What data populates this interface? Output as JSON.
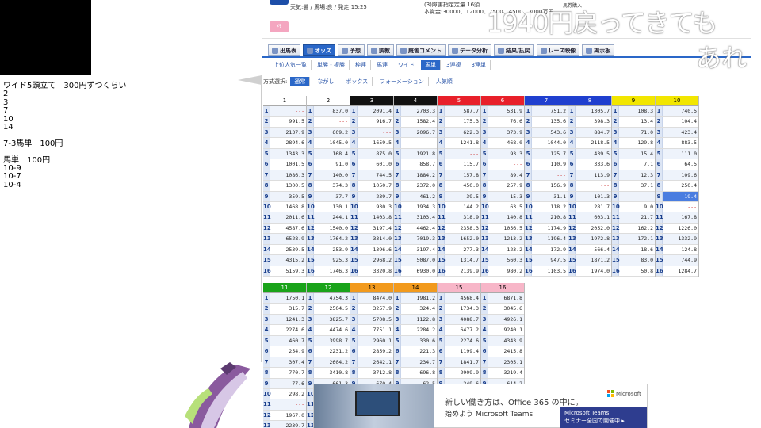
{
  "header": {
    "info_line1": "天気:曇 / 馬場:良 / 発走:15:25",
    "info_line2": "(3)障害指定定量 16頭",
    "info_line3": "本賞金:30000、12000、7500、4500、3000万円",
    "buy_label": "馬券購入",
    "pink_button": "ﾒﾓ"
  },
  "stream_overlay": {
    "line1": "1940円戻ってきても",
    "line2": "あれ"
  },
  "memo": {
    "lines": [
      "ワイド5頭立て　300円ずつくらい",
      "2",
      "3",
      "7",
      "10",
      "14",
      "",
      "7-3馬単　100円",
      "",
      "馬単　100円",
      "10-9",
      "10-7",
      "10-4"
    ]
  },
  "main_tabs": [
    {
      "label": "出馬表",
      "icon": "list-icon"
    },
    {
      "label": "オッズ",
      "icon": "odds-icon",
      "active": true
    },
    {
      "label": "予想",
      "icon": "target-icon"
    },
    {
      "label": "調教",
      "icon": "horse-icon"
    },
    {
      "label": "厩舎コメント",
      "icon": "stable-icon"
    },
    {
      "label": "データ分析",
      "icon": "data-icon"
    },
    {
      "label": "結果/払戻",
      "icon": "result-icon"
    },
    {
      "label": "レース映像",
      "icon": "video-icon"
    },
    {
      "label": "掲示板",
      "icon": "board-icon"
    }
  ],
  "sub_tabs": [
    {
      "label": "上位人気一覧"
    },
    {
      "label": "単勝・複勝"
    },
    {
      "label": "枠連"
    },
    {
      "label": "馬連"
    },
    {
      "label": "ワイド"
    },
    {
      "label": "馬単",
      "active": true
    },
    {
      "label": "3連複"
    },
    {
      "label": "3連単"
    }
  ],
  "mode": {
    "label": "方式選択:",
    "buttons": [
      {
        "label": "通常",
        "active": true
      },
      {
        "label": "ながし"
      },
      {
        "label": "ボックス"
      },
      {
        "label": "フォーメーション"
      },
      {
        "label": "人気順"
      }
    ]
  },
  "odds_top": {
    "columns": [
      {
        "head": "1",
        "color": "#ffffff",
        "text": "#000",
        "values": [
          "---",
          "991.5",
          "2137.9",
          "2894.6",
          "1343.3",
          "1001.5",
          "1086.3",
          "1300.5",
          "359.5",
          "1468.8",
          "2011.6",
          "4587.6",
          "6528.9",
          "2539.5",
          "4315.2",
          "5159.3"
        ]
      },
      {
        "head": "2",
        "color": "#ffffff",
        "text": "#000",
        "values": [
          "837.0",
          "---",
          "609.2",
          "1045.0",
          "168.4",
          "91.0",
          "140.0",
          "374.3",
          "37.7",
          "130.1",
          "244.1",
          "1540.0",
          "1764.2",
          "253.9",
          "925.3",
          "1746.3"
        ]
      },
      {
        "head": "3",
        "color": "#111111",
        "text": "#fff",
        "values": [
          "2091.4",
          "916.7",
          "---",
          "1659.5",
          "875.0",
          "601.0",
          "744.5",
          "1050.7",
          "239.7",
          "930.3",
          "1403.8",
          "3197.4",
          "3314.0",
          "1396.6",
          "2968.2",
          "3320.8"
        ]
      },
      {
        "head": "4",
        "color": "#111111",
        "text": "#fff",
        "values": [
          "2703.3",
          "1582.4",
          "2096.7",
          "---",
          "1921.8",
          "858.7",
          "1884.2",
          "2372.0",
          "461.2",
          "1934.3",
          "3103.4",
          "4462.4",
          "7019.3",
          "3197.4",
          "5087.0",
          "6930.0"
        ]
      },
      {
        "head": "5",
        "color": "#e8202a",
        "text": "#fff",
        "values": [
          "587.7",
          "175.3",
          "622.3",
          "1241.8",
          "---",
          "115.7",
          "157.8",
          "450.0",
          "39.5",
          "144.2",
          "318.9",
          "2358.3",
          "1652.0",
          "277.3",
          "1314.7",
          "2139.9"
        ]
      },
      {
        "head": "6",
        "color": "#e8202a",
        "text": "#fff",
        "values": [
          "531.9",
          "76.6",
          "373.9",
          "468.0",
          "93.3",
          "---",
          "89.4",
          "257.9",
          "15.3",
          "63.5",
          "140.8",
          "1056.5",
          "1213.2",
          "123.2",
          "560.3",
          "980.2"
        ]
      },
      {
        "head": "7",
        "color": "#1f3fcf",
        "text": "#fff",
        "values": [
          "751.2",
          "135.6",
          "543.6",
          "1044.0",
          "125.7",
          "110.9",
          "---",
          "156.9",
          "31.1",
          "118.2",
          "210.8",
          "1174.9",
          "1196.4",
          "172.9",
          "947.5",
          "1103.5"
        ]
      },
      {
        "head": "8",
        "color": "#1f3fcf",
        "text": "#fff",
        "values": [
          "1305.7",
          "398.3",
          "884.7",
          "2118.5",
          "439.5",
          "333.6",
          "113.9",
          "---",
          "101.3",
          "281.7",
          "603.1",
          "2052.0",
          "1972.8",
          "566.4",
          "1871.2",
          "1974.0"
        ]
      },
      {
        "head": "9",
        "color": "#f2e600",
        "text": "#000",
        "values": [
          "108.3",
          "13.4",
          "71.0",
          "129.8",
          "15.4",
          "7.1",
          "12.3",
          "37.1",
          "---",
          "9.0",
          "21.7",
          "162.2",
          "172.1",
          "18.6",
          "83.0",
          "50.8"
        ]
      },
      {
        "head": "10",
        "color": "#f2e600",
        "text": "#000",
        "values": [
          "740.5",
          "104.4",
          "423.4",
          "883.5",
          "111.0",
          "64.5",
          "109.6",
          "250.4",
          "19.4",
          "---",
          "167.8",
          "1226.0",
          "1332.9",
          "124.8",
          "744.9",
          "1284.7"
        ]
      }
    ]
  },
  "odds_bottom": {
    "columns": [
      {
        "head": "11",
        "color": "#1aa31a",
        "text": "#fff",
        "values": [
          "1750.1",
          "315.7",
          "1241.3",
          "2274.6",
          "460.7",
          "254.9",
          "307.4",
          "770.7",
          "77.6",
          "298.2",
          "---",
          "1967.0",
          "2239.7"
        ]
      },
      {
        "head": "12",
        "color": "#1aa31a",
        "text": "#fff",
        "values": [
          "4754.3",
          "2504.5",
          "3825.7",
          "4474.6",
          "3998.7",
          "2231.2",
          "2604.2",
          "3410.8",
          "661.3",
          "",
          "",
          "",
          ""
        ]
      },
      {
        "head": "13",
        "color": "#f29a1d",
        "text": "#000",
        "values": [
          "8474.0",
          "3257.9",
          "5708.5",
          "7751.1",
          "2960.1",
          "2859.2",
          "2642.1",
          "3712.8",
          "670.4",
          "",
          "",
          "",
          ""
        ]
      },
      {
        "head": "14",
        "color": "#f29a1d",
        "text": "#000",
        "values": [
          "1981.2",
          "324.4",
          "1122.8",
          "2284.2",
          "330.6",
          "221.3",
          "234.7",
          "696.8",
          "62.5",
          "",
          "",
          "",
          ""
        ]
      },
      {
        "head": "15",
        "color": "#f7b6c8",
        "text": "#000",
        "values": [
          "4568.4",
          "1734.3",
          "4088.7",
          "6477.2",
          "2274.6",
          "1199.4",
          "1841.7",
          "2909.9",
          "249.6",
          "",
          "",
          "",
          ""
        ]
      },
      {
        "head": "16",
        "color": "#f7b6c8",
        "text": "#000",
        "values": [
          "6871.8",
          "3045.6",
          "4926.1",
          "9240.1",
          "4343.9",
          "2415.8",
          "2305.1",
          "3219.4",
          "614.2",
          "",
          "",
          "",
          ""
        ]
      }
    ]
  },
  "ad": {
    "line1": "新しい働き方は、Office 365 の中に。",
    "line2": "始めよう Microsoft Teams",
    "brand": "Microsoft",
    "box_line1": "Microsoft Teams",
    "box_line2": "セミナー全国で開催中 ▸"
  }
}
